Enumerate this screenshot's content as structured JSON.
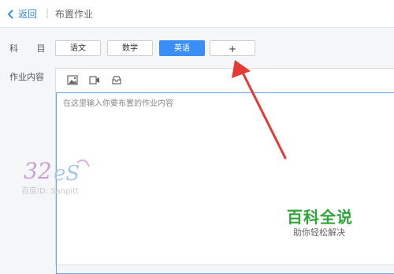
{
  "header": {
    "back_label": "返回",
    "separator": "|",
    "title": "布置作业"
  },
  "subject": {
    "label": "科 目",
    "options": [
      "语文",
      "数学",
      "英语"
    ],
    "selected": "英语",
    "add_label": "+"
  },
  "content": {
    "label": "作业内容",
    "placeholder": "在这里输入你要布置的作业内容"
  },
  "toolbar_icons": [
    "image-icon",
    "video-icon",
    "inbox-icon"
  ],
  "watermark": {
    "text": "百度ID: Sanpitt"
  },
  "branding": {
    "main": "百科全说",
    "sub": "助你轻松解决"
  },
  "colors": {
    "accent": "#3a8ef6",
    "arrow": "#e53935",
    "brand_green": "#2fa53b"
  }
}
